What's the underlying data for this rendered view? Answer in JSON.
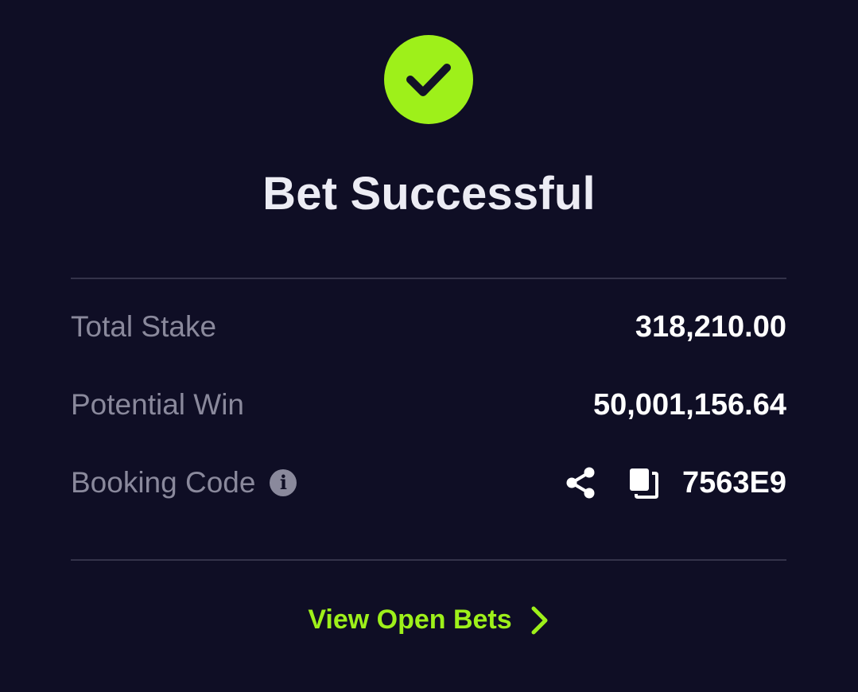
{
  "status": {
    "icon": "check-icon",
    "title": "Bet Successful"
  },
  "summary": {
    "total_stake": {
      "label": "Total Stake",
      "value": "318,210.00"
    },
    "potential_win": {
      "label": "Potential Win",
      "value": "50,001,156.64"
    },
    "booking_code": {
      "label": "Booking Code",
      "info_icon_glyph": "i",
      "value": "7563E9",
      "icons": [
        "info-icon",
        "share-icon",
        "copy-icon"
      ]
    }
  },
  "footer": {
    "view_open_bets_label": "View Open Bets",
    "icon": "chevron-right-icon"
  },
  "colors": {
    "background": "#0f0e25",
    "accent": "#9ef01a",
    "label": "#8a899c",
    "divider": "#34334a"
  }
}
